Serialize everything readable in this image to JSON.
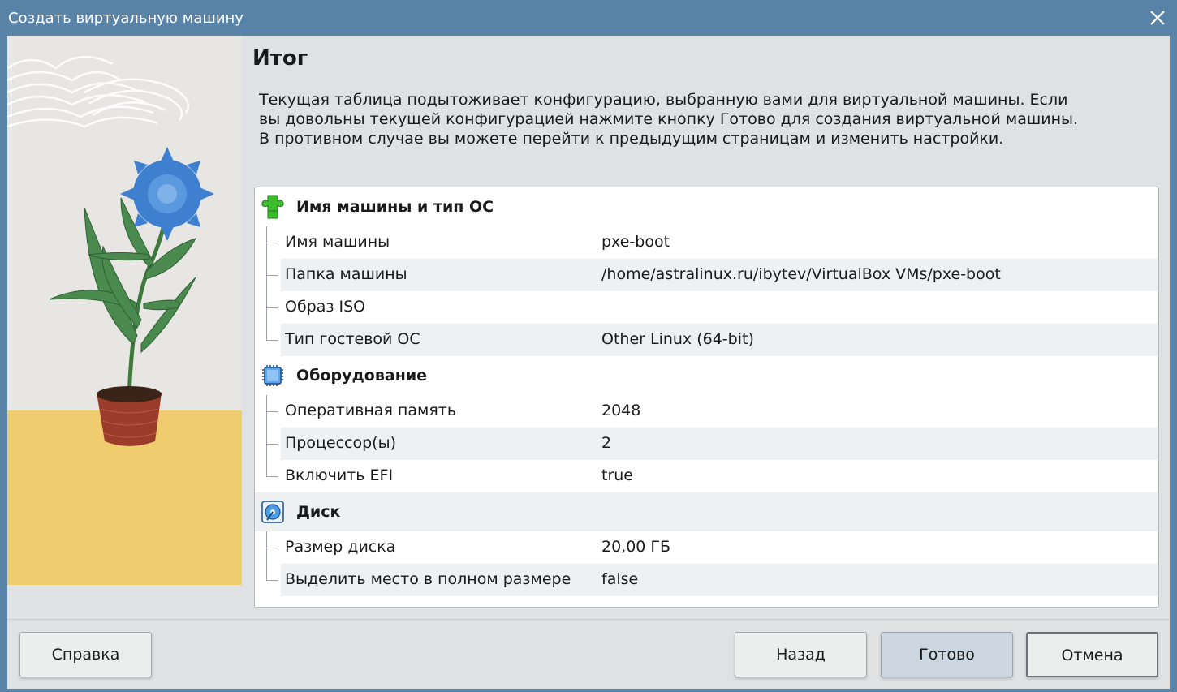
{
  "window": {
    "title": "Создать виртуальную машину"
  },
  "page": {
    "heading": "Итог",
    "description": "Текущая таблица подытоживает конфигурацию, выбранную вами для виртуальной машины. Если вы довольны текущей конфигурацией нажмите кнопку Готово для создания виртуальной машины. В противном случае вы можете перейти к предыдущим страницам и изменить настройки."
  },
  "summary": {
    "sections": [
      {
        "label": "Имя машины и тип ОС",
        "icon": "puzzle-icon",
        "rows": [
          {
            "key": "Имя машины",
            "value": "pxe-boot"
          },
          {
            "key": "Папка машины",
            "value": "/home/astralinux.ru/ibytev/VirtualBox VMs/pxe-boot"
          },
          {
            "key": "Образ ISO",
            "value": ""
          },
          {
            "key": "Тип гостевой ОС",
            "value": "Other Linux (64-bit)"
          }
        ]
      },
      {
        "label": "Оборудование",
        "icon": "chip-icon",
        "rows": [
          {
            "key": "Оперативная память",
            "value": "2048"
          },
          {
            "key": "Процессор(ы)",
            "value": "2"
          },
          {
            "key": "Включить EFI",
            "value": "true"
          }
        ]
      },
      {
        "label": "Диск",
        "icon": "hard-disk-icon",
        "rows": [
          {
            "key": "Размер диска",
            "value": "20,00 ГБ"
          },
          {
            "key": "Выделить место в полном размере",
            "value": "false"
          }
        ]
      }
    ]
  },
  "buttons": {
    "help": "Справка",
    "back": "Назад",
    "finish": "Готово",
    "cancel": "Отмена"
  },
  "colors": {
    "titlebar": "#5a83a8",
    "dialog_bg": "#dfe1e3",
    "alt_row": "#eef0f2",
    "default_button": "#cdd7e2"
  }
}
